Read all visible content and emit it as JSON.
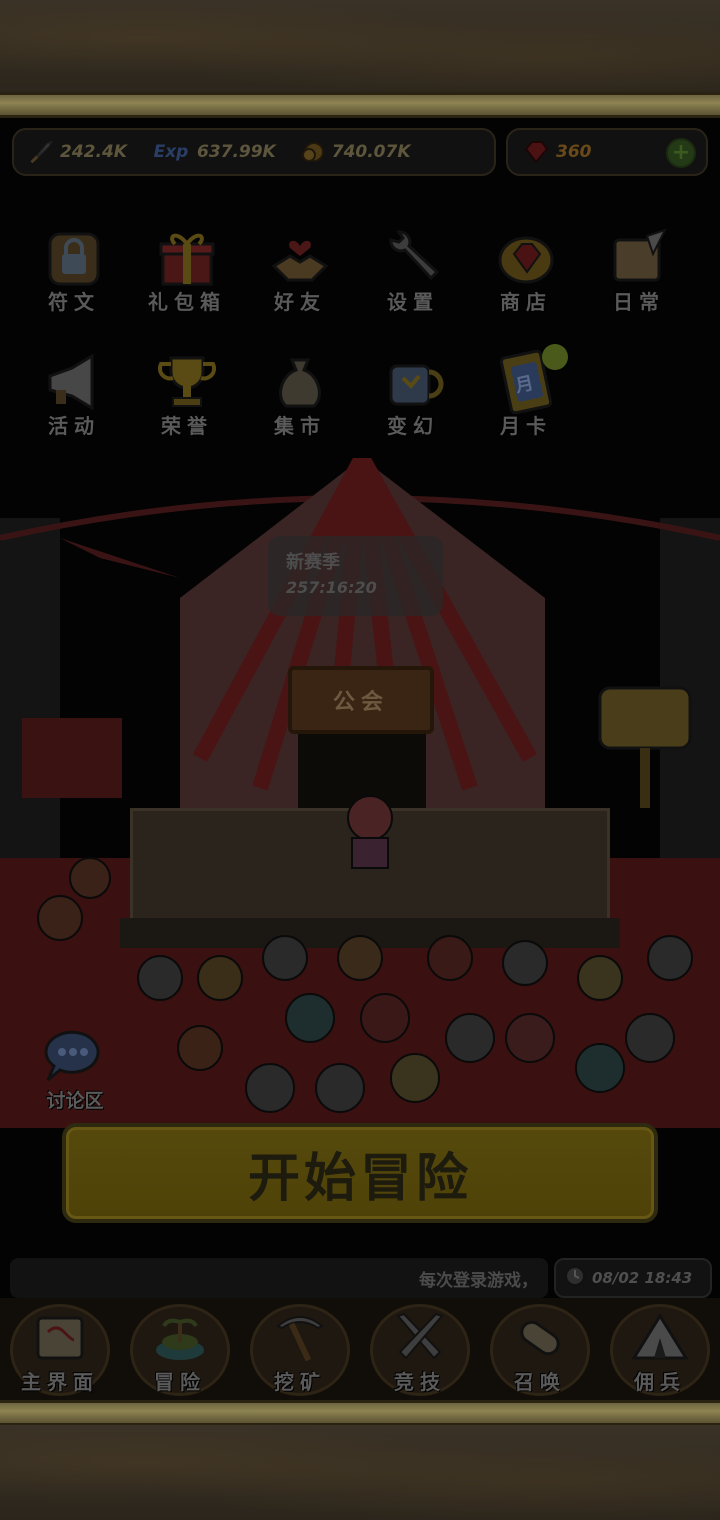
{
  "resources": {
    "attack": "242.4K",
    "exp_icon": "Exp",
    "exp": "637.99K",
    "gold": "740.07K",
    "gems": "360"
  },
  "menu_row1": [
    {
      "label": "符文",
      "icon": "rune-lock-icon"
    },
    {
      "label": "礼包箱",
      "icon": "gift-box-icon"
    },
    {
      "label": "好友",
      "icon": "handshake-heart-icon"
    },
    {
      "label": "设置",
      "icon": "wrench-icon"
    },
    {
      "label": "商店",
      "icon": "shop-gem-icon"
    },
    {
      "label": "日常",
      "icon": "scroll-quill-icon"
    }
  ],
  "menu_row2": [
    {
      "label": "活动",
      "icon": "megaphone-icon"
    },
    {
      "label": "荣誉",
      "icon": "trophy-icon"
    },
    {
      "label": "集市",
      "icon": "money-bag-icon"
    },
    {
      "label": "变幻",
      "icon": "magic-box-icon"
    },
    {
      "label": "月卡",
      "icon": "month-card-icon",
      "card_char": "月"
    }
  ],
  "season": {
    "title": "新赛季",
    "countdown": "257:16:20"
  },
  "guild_sign": "公会",
  "forum": {
    "label": "讨论区",
    "icon": "chat-bubble-icon"
  },
  "start_button": "开始冒险",
  "notice": "每次登录游戏，",
  "clock": "08/02 18:43",
  "nav": [
    {
      "label": "主界面",
      "icon": "map-scroll-icon"
    },
    {
      "label": "冒险",
      "icon": "island-icon"
    },
    {
      "label": "挖矿",
      "icon": "pickaxe-icon"
    },
    {
      "label": "竞技",
      "icon": "crossed-swords-icon"
    },
    {
      "label": "召唤",
      "icon": "summon-scroll-icon"
    },
    {
      "label": "佣兵",
      "icon": "tent-icon"
    }
  ],
  "colors": {
    "dim_gold": "#4e4208",
    "gem": "#6a4a18",
    "plus": "#3c5a20"
  }
}
